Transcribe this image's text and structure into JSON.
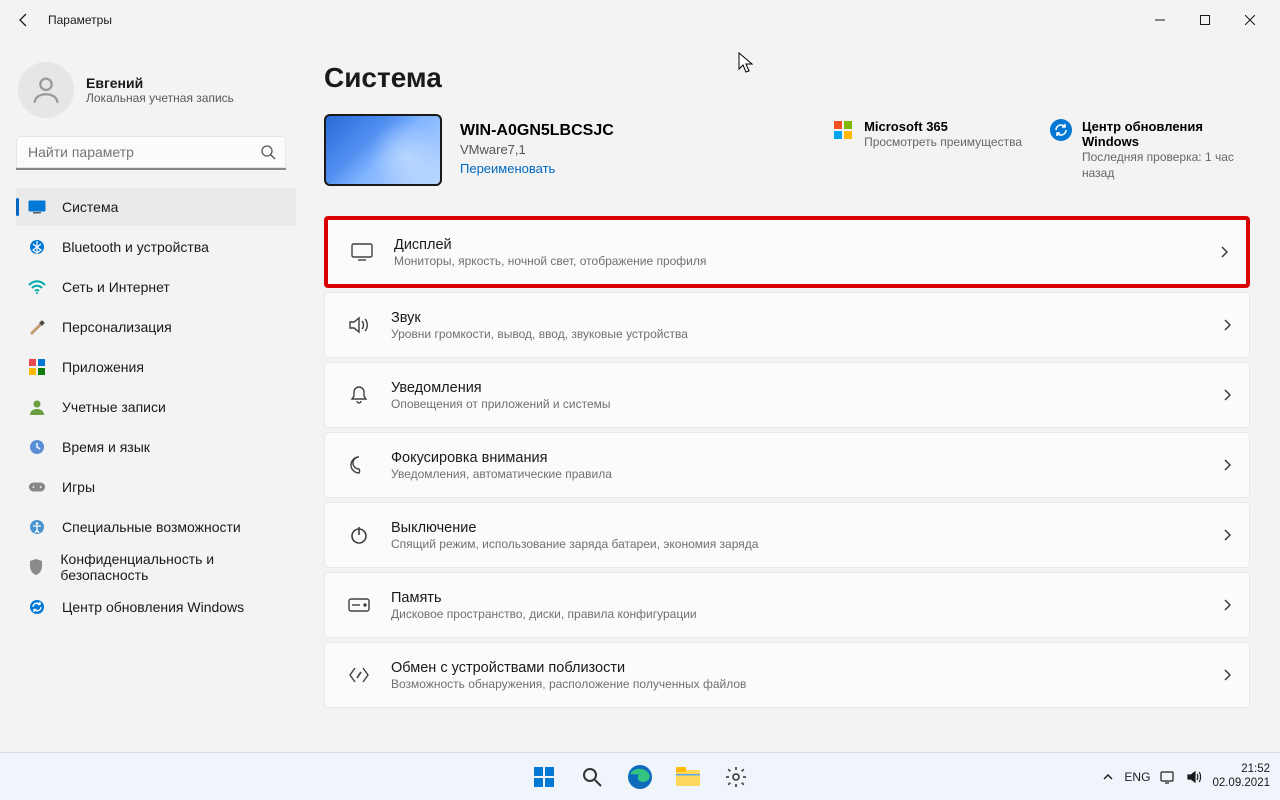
{
  "window": {
    "title": "Параметры"
  },
  "account": {
    "name": "Евгений",
    "sub": "Локальная учетная запись"
  },
  "search": {
    "placeholder": "Найти параметр"
  },
  "nav": [
    {
      "id": "system",
      "label": "Система",
      "active": true
    },
    {
      "id": "bluetooth",
      "label": "Bluetooth и устройства"
    },
    {
      "id": "network",
      "label": "Сеть и Интернет"
    },
    {
      "id": "personalization",
      "label": "Персонализация"
    },
    {
      "id": "apps",
      "label": "Приложения"
    },
    {
      "id": "accounts",
      "label": "Учетные записи"
    },
    {
      "id": "time",
      "label": "Время и язык"
    },
    {
      "id": "gaming",
      "label": "Игры"
    },
    {
      "id": "accessibility",
      "label": "Специальные возможности"
    },
    {
      "id": "privacy",
      "label": "Конфиденциальность и безопасность"
    },
    {
      "id": "update",
      "label": "Центр обновления Windows"
    }
  ],
  "page": {
    "title": "Система"
  },
  "device": {
    "name": "WIN-A0GN5LBCSJC",
    "model": "VMware7,1",
    "rename": "Переименовать"
  },
  "tiles": {
    "ms365": {
      "title": "Microsoft 365",
      "desc": "Просмотреть преимущества"
    },
    "update": {
      "title": "Центр обновления Windows",
      "desc": "Последняя проверка: 1 час назад"
    }
  },
  "cards": [
    {
      "id": "display",
      "title": "Дисплей",
      "desc": "Мониторы, яркость, ночной свет, отображение профиля",
      "highlight": true
    },
    {
      "id": "sound",
      "title": "Звук",
      "desc": "Уровни громкости, вывод, ввод, звуковые устройства"
    },
    {
      "id": "notifications",
      "title": "Уведомления",
      "desc": "Оповещения от приложений и системы"
    },
    {
      "id": "focus",
      "title": "Фокусировка внимания",
      "desc": "Уведомления, автоматические правила"
    },
    {
      "id": "power",
      "title": "Выключение",
      "desc": "Спящий режим, использование заряда батареи, экономия заряда"
    },
    {
      "id": "storage",
      "title": "Память",
      "desc": "Дисковое пространство, диски, правила конфигурации"
    },
    {
      "id": "nearby",
      "title": "Обмен с устройствами поблизости",
      "desc": "Возможность обнаружения, расположение полученных файлов"
    }
  ],
  "taskbar": {
    "lang": "ENG",
    "time": "21:52",
    "date": "02.09.2021"
  }
}
